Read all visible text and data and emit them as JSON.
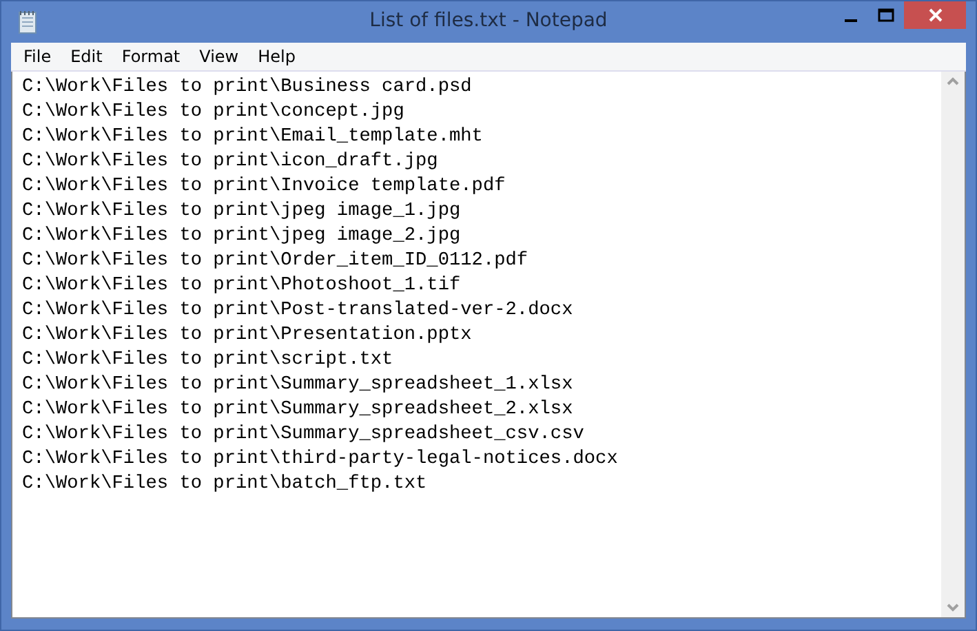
{
  "window": {
    "title": "List of files.txt - Notepad"
  },
  "menu": [
    "File",
    "Edit",
    "Format",
    "View",
    "Help"
  ],
  "lines": [
    "C:\\Work\\Files to print\\Business card.psd",
    "C:\\Work\\Files to print\\concept.jpg",
    "C:\\Work\\Files to print\\Email_template.mht",
    "C:\\Work\\Files to print\\icon_draft.jpg",
    "C:\\Work\\Files to print\\Invoice template.pdf",
    "C:\\Work\\Files to print\\jpeg image_1.jpg",
    "C:\\Work\\Files to print\\jpeg image_2.jpg",
    "C:\\Work\\Files to print\\Order_item_ID_0112.pdf",
    "C:\\Work\\Files to print\\Photoshoot_1.tif",
    "C:\\Work\\Files to print\\Post-translated-ver-2.docx",
    "C:\\Work\\Files to print\\Presentation.pptx",
    "C:\\Work\\Files to print\\script.txt",
    "C:\\Work\\Files to print\\Summary_spreadsheet_1.xlsx",
    "C:\\Work\\Files to print\\Summary_spreadsheet_2.xlsx",
    "C:\\Work\\Files to print\\Summary_spreadsheet_csv.csv",
    "C:\\Work\\Files to print\\third-party-legal-notices.docx",
    "C:\\Work\\Files to print\\batch_ftp.txt"
  ]
}
